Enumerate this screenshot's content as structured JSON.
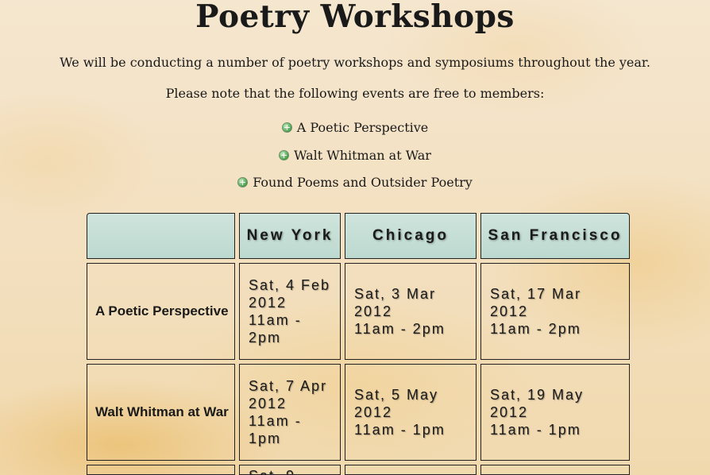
{
  "page": {
    "title": "Poetry Workshops",
    "intro": "We will be conducting a number of poetry workshops and symposiums throughout the year.",
    "free_note": "Please note that the following events are free to members:",
    "free_events": [
      "A Poetic Perspective",
      "Walt Whitman at War",
      "Found Poems and Outsider Poetry"
    ]
  },
  "schedule": {
    "columns": [
      "New York",
      "Chicago",
      "San Francisco"
    ],
    "rows": [
      {
        "event": "A Poetic Perspective",
        "sessions": [
          "Sat, 4 Feb 2012\n11am - 2pm",
          "Sat, 3 Mar 2012\n11am - 2pm",
          "Sat, 17 Mar 2012\n11am - 2pm"
        ]
      },
      {
        "event": "Walt Whitman at War",
        "sessions": [
          "Sat, 7 Apr 2012\n11am - 1pm",
          "Sat, 5 May 2012\n11am - 1pm",
          "Sat, 19 May 2012\n11am - 1pm"
        ]
      }
    ],
    "partial_row": {
      "sessions": [
        "Sat, 9"
      ]
    }
  }
}
